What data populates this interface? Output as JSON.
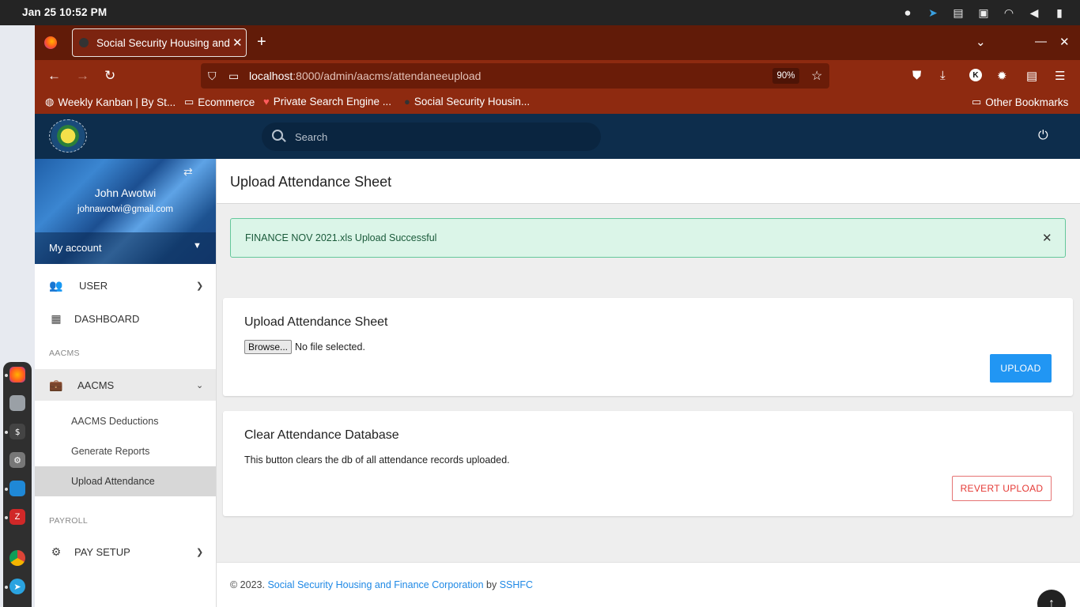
{
  "os": {
    "clock": "Jan 25  10:52 PM",
    "tray_icons": [
      "screen-record-icon",
      "telegram-icon",
      "clipboard-icon",
      "display-icon",
      "wifi-icon",
      "volume-icon",
      "battery-icon"
    ]
  },
  "browser": {
    "tab_title": "Social Security Housing and Finance Corporation",
    "url_host": "localhost",
    "url_path": ":8000/admin/aacms/attendaneeupload",
    "zoom": "90%",
    "bookmarks": [
      {
        "label": "Weekly Kanban | By St...",
        "icon": "globe-icon"
      },
      {
        "label": "Ecommerce",
        "icon": "folder-icon"
      },
      {
        "label": "Private Search Engine ...",
        "icon": "shield-icon"
      },
      {
        "label": "Social Security Housin...",
        "icon": "site-icon"
      }
    ],
    "other_bookmarks": "Other Bookmarks"
  },
  "header": {
    "search_placeholder": "Search"
  },
  "sidebar": {
    "user_name": "John Awotwi",
    "user_email": "johnawotwi@gmail.com",
    "my_account": "My account",
    "items": {
      "user": "USER",
      "dashboard": "DASHBOARD",
      "aacms_cat": "AACMS",
      "aacms": "AACMS",
      "aacms_deductions": "AACMS Deductions",
      "generate_reports": "Generate Reports",
      "upload_attendance": "Upload Attendance",
      "payroll_cat": "PAYROLL",
      "pay_setup": "PAY SETUP"
    }
  },
  "main": {
    "page_title": "Upload Attendance Sheet",
    "alert": "FINANCE NOV 2021.xls Upload Successful",
    "upload_card": {
      "title": "Upload Attendance Sheet",
      "browse_label": "Browse...",
      "no_file": "No file selected.",
      "upload_button": "UPLOAD"
    },
    "clear_card": {
      "title": "Clear Attendance Database",
      "description": "This button clears the db of all attendance records uploaded.",
      "revert_button": "REVERT UPLOAD"
    }
  },
  "footer": {
    "prefix": "© 2023.",
    "org": "Social Security Housing and Finance Corporation",
    "by": "by",
    "author": "SSHFC"
  },
  "colors": {
    "tab_bar": "#611b08",
    "nav_bar": "#8e2a10",
    "app_header": "#0d2d4c",
    "primary": "#2196f3",
    "danger": "#e53935",
    "success_bg": "#dbf5e8"
  }
}
